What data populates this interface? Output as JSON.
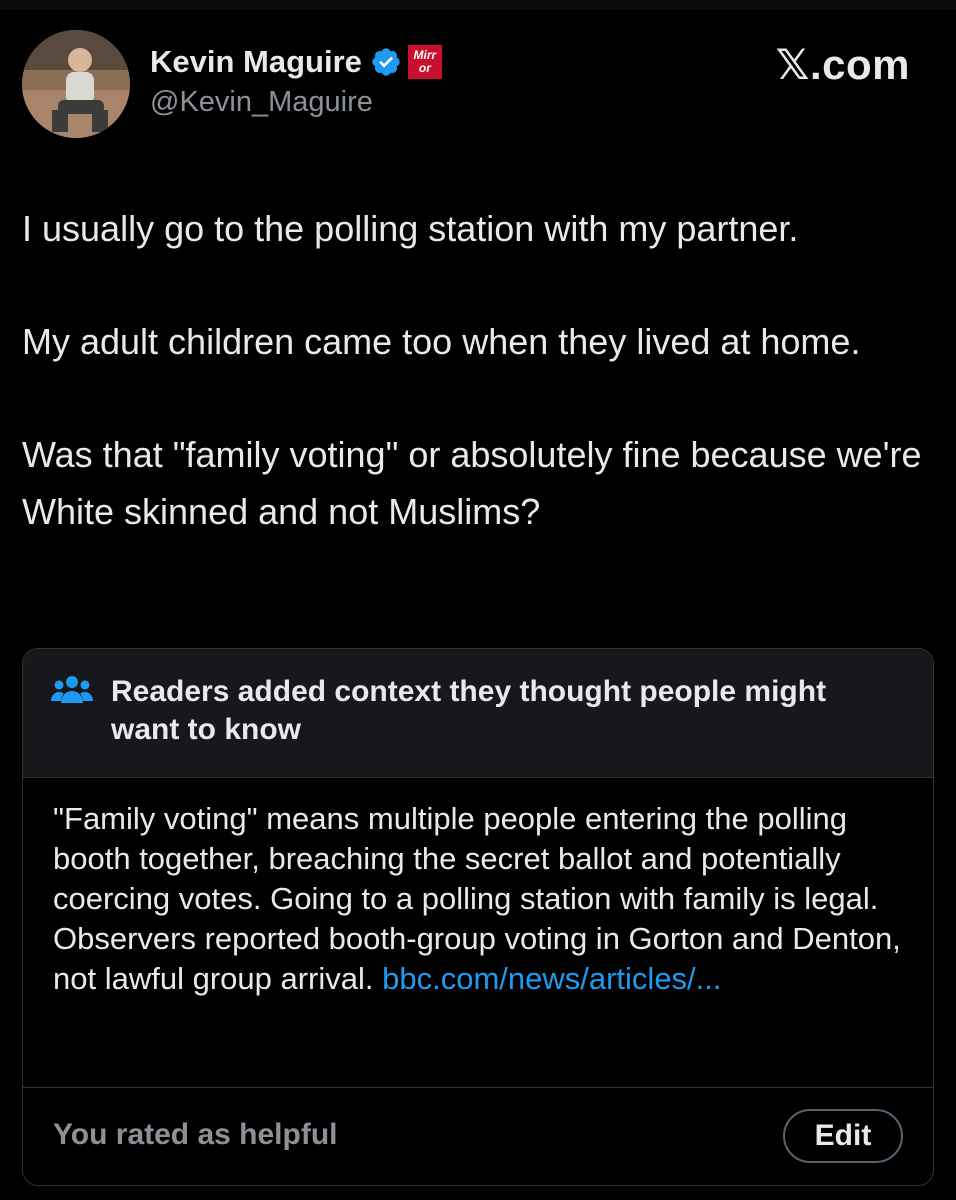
{
  "author": {
    "name": "Kevin Maguire",
    "handle": "@Kevin_Maguire",
    "affiliation_badge": "Mirror",
    "verified_icon": "verified-badge-icon",
    "verified_color": "#1d9bf0"
  },
  "watermark": "𝕏.com",
  "tweet": {
    "paragraphs": [
      "I usually go to the polling station with my partner.",
      "My adult children came too when they lived at home.",
      "Was that \"family voting\" or absolutely fine because we're White skinned and not Muslims?"
    ]
  },
  "community_note": {
    "icon": "people-icon",
    "title": "Readers added context they thought people might want to know",
    "body": "\"Family voting\" means multiple people entering the polling booth together, breaching the secret ballot and potentially coercing votes. Going to a polling station with family is legal. Observers reported booth-group voting in Gorton and Denton, not lawful group arrival. ",
    "link": "bbc.com/news/articles/...",
    "rating_status": "You rated as helpful",
    "edit_label": "Edit",
    "link_color": "#1d9bf0"
  }
}
